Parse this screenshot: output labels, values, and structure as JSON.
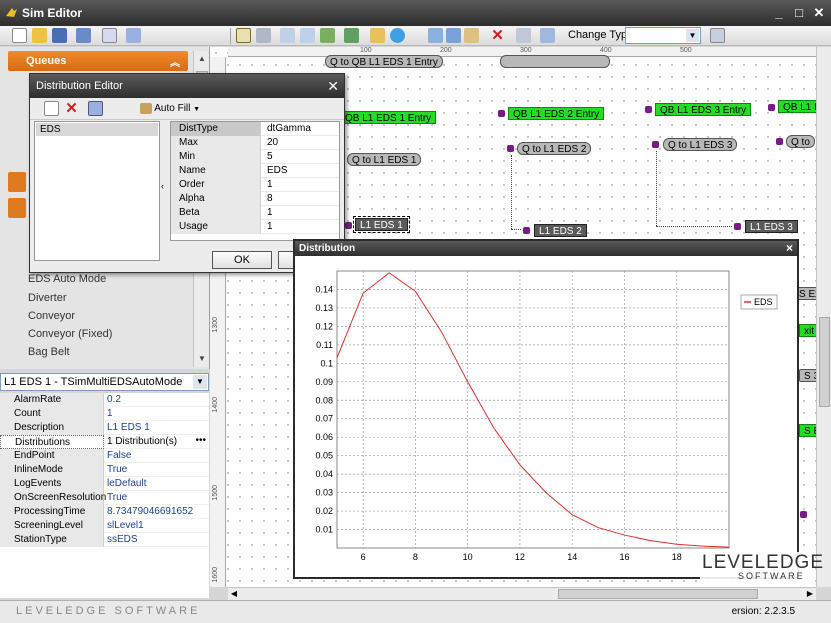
{
  "window": {
    "title": "Sim Editor",
    "minimize": "_",
    "maximize": "□",
    "close": "✕"
  },
  "toolbar": {
    "change_type_label": "Change Type",
    "change_type_value": ""
  },
  "palette": {
    "header": "Queues",
    "items": [
      "EDS Auto Mode",
      "Diverter",
      "Conveyor",
      "Conveyor (Fixed)",
      "Bag Belt"
    ]
  },
  "object_selector": {
    "value": "L1 EDS 1 - TSimMultiEDSAutoMode"
  },
  "properties": [
    {
      "name": "AlarmRate",
      "value": "0.2"
    },
    {
      "name": "Count",
      "value": "1"
    },
    {
      "name": "Description",
      "value": "L1 EDS 1"
    },
    {
      "name": "Distributions",
      "value": "1 Distribution(s)"
    },
    {
      "name": "EndPoint",
      "value": "False"
    },
    {
      "name": "InlineMode",
      "value": "True"
    },
    {
      "name": "LogEvents",
      "value": "leDefault"
    },
    {
      "name": "OnScreenResolution",
      "value": "True"
    },
    {
      "name": "ProcessingTime",
      "value": "8.73479046691652"
    },
    {
      "name": "ScreeningLevel",
      "value": "slLevel1"
    },
    {
      "name": "StationType",
      "value": "ssEDS"
    }
  ],
  "ruler": {
    "h_ticks": [
      "100",
      "200",
      "300",
      "400",
      "500"
    ],
    "v_ticks": [
      "1300",
      "1400",
      "1500",
      "1600"
    ]
  },
  "canvas_nodes": {
    "entry1": "QB L1 EDS 1 Entry",
    "entry2": "QB L1 EDS 2 Entry",
    "entry3": "QB L1 EDS 3 Entry",
    "entry4": "QB L1 ED",
    "q1": "Q to L1 EDS 1",
    "q2": "Q to L1 EDS 2",
    "q3": "Q to L1 EDS 3",
    "q4": "Q to",
    "eds1": "L1 EDS 1",
    "eds2": "L1 EDS 2",
    "eds3": "L1 EDS 3",
    "top_partial": "Q to QB L1 EDS 1 Entry",
    "right_partials": [
      "S Ex",
      "xit",
      "S 3",
      "S Ex"
    ]
  },
  "dist_editor": {
    "title": "Distribution Editor",
    "autofill_label": "Auto Fill",
    "list_items": [
      "EDS"
    ],
    "params": [
      {
        "name": "DistType",
        "value": "dtGamma"
      },
      {
        "name": "Max",
        "value": "20"
      },
      {
        "name": "Min",
        "value": "5"
      },
      {
        "name": "Name",
        "value": "EDS"
      },
      {
        "name": "Order",
        "value": "1"
      },
      {
        "name": "Alpha",
        "value": "8"
      },
      {
        "name": "Beta",
        "value": "1"
      },
      {
        "name": "Usage",
        "value": "1"
      }
    ],
    "ok_label": "OK"
  },
  "dist_window": {
    "title": "Distribution",
    "close": "×"
  },
  "chart_data": {
    "type": "line",
    "title": "",
    "xlabel": "",
    "ylabel": "",
    "xlim": [
      5,
      20
    ],
    "ylim": [
      0,
      0.15
    ],
    "x_ticks": [
      6,
      8,
      10,
      12,
      14,
      16,
      18
    ],
    "y_ticks": [
      0.01,
      0.02,
      0.03,
      0.04,
      0.05,
      0.06,
      0.07,
      0.08,
      0.09,
      0.1,
      0.11,
      0.12,
      0.13,
      0.14
    ],
    "grid": true,
    "legend": "top-right",
    "series": [
      {
        "name": "EDS",
        "color": "#e03030",
        "x": [
          5,
          6,
          7,
          8,
          9,
          10,
          11,
          12,
          13,
          14,
          15,
          16,
          17,
          18,
          19,
          20
        ],
        "y": [
          0.103,
          0.138,
          0.149,
          0.139,
          0.117,
          0.09,
          0.065,
          0.045,
          0.03,
          0.018,
          0.011,
          0.007,
          0.004,
          0.002,
          0.001,
          0.0005
        ]
      }
    ]
  },
  "branding": {
    "status_logo": "LEVELEDGE SOFTWARE",
    "version": "ersion: 2.2.3.5",
    "brand_main": "LEVELEDGE",
    "brand_sub": "SOFTWARE"
  },
  "icons": [
    "app-icon",
    "new-icon",
    "open-icon",
    "save-icon",
    "delete-icon",
    "auto-fill-icon",
    "chevron-up-icon",
    "chevron-down-icon"
  ],
  "colors": {
    "accent_orange": "#e07a20",
    "node_green": "#22dd22",
    "curve_red": "#e03030"
  }
}
